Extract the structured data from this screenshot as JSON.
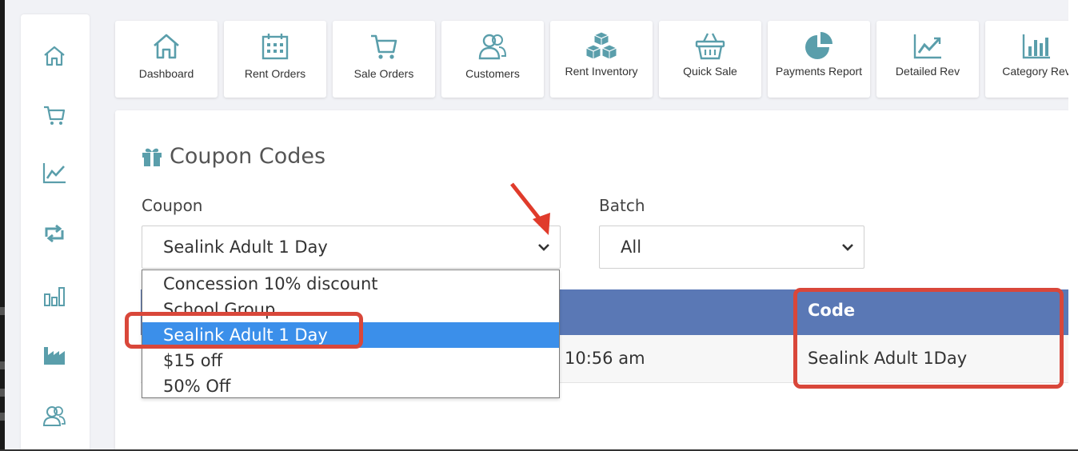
{
  "nav_tiles": [
    {
      "label": "Dashboard",
      "icon": "home-icon"
    },
    {
      "label": "Rent Orders",
      "icon": "calendar-icon"
    },
    {
      "label": "Sale Orders",
      "icon": "cart-icon"
    },
    {
      "label": "Customers",
      "icon": "users-icon"
    },
    {
      "label": "Rent Inventory",
      "icon": "boxes-icon"
    },
    {
      "label": "Quick Sale",
      "icon": "basket-icon"
    },
    {
      "label": "Payments Report",
      "icon": "pie-chart-icon"
    },
    {
      "label": "Detailed Rev",
      "icon": "line-chart-icon"
    },
    {
      "label": "Category Rev",
      "icon": "bar-chart-icon"
    }
  ],
  "sidebar_icons": [
    "home-icon",
    "cart-icon",
    "line-chart-icon",
    "retweet-icon",
    "bar-chart-icon",
    "industry-icon",
    "users-icon"
  ],
  "page": {
    "title": "Coupon Codes",
    "title_icon": "gift-icon"
  },
  "filters": {
    "coupon_label": "Coupon",
    "coupon_value": "Sealink Adult 1 Day",
    "batch_label": "Batch",
    "batch_value": "All"
  },
  "coupon_options": [
    "Concession 10% discount",
    "School Group",
    "Sealink Adult 1 Day",
    "$15 off",
    "50% Off"
  ],
  "table": {
    "header_code": "Code",
    "row_time": "10:56 am",
    "row_code": "Sealink Adult 1Day"
  },
  "colors": {
    "accent": "#5a9eab",
    "table_header": "#5a78b5",
    "selection": "#3b8fea",
    "annotation": "#d9473a"
  }
}
